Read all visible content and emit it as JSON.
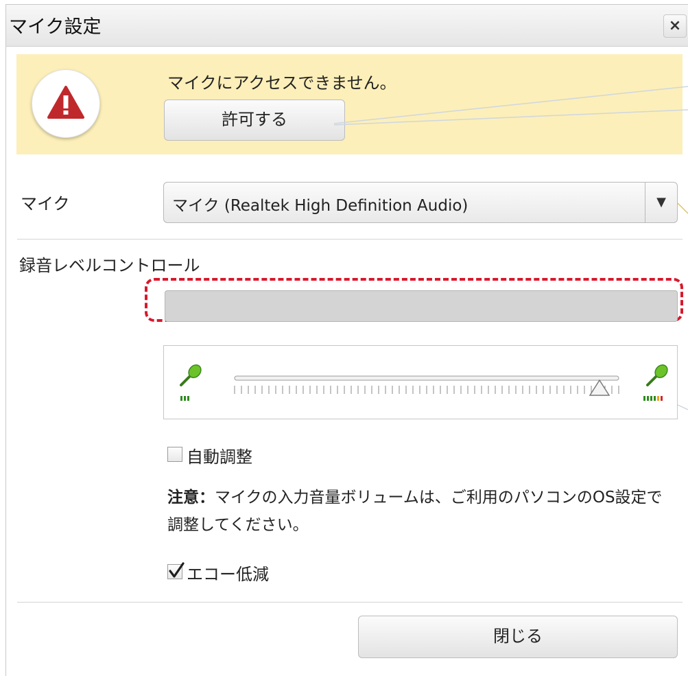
{
  "dialog": {
    "title": "マイク設定",
    "close_icon": "×"
  },
  "warning": {
    "icon": "warning-triangle-icon",
    "message": "マイクにアクセスできません。",
    "allow_button": "許可する",
    "background_color": "#fcefb9",
    "icon_color": "#c0292c"
  },
  "mic": {
    "label": "マイク",
    "selected_device": "マイク (Realtek High Definition Audio)",
    "dropdown_icon": "▼"
  },
  "recording": {
    "label": "録音レベルコントロール",
    "highlight_color": "#d8182d",
    "slider_level": 0.95
  },
  "auto_adjust": {
    "label": "自動調整",
    "checked": false
  },
  "note": {
    "prefix": "注意：",
    "text": "マイクの入力音量ボリュームは、ご利用のパソコンのOS設定で調整してください。"
  },
  "echo_reduction": {
    "label": "エコー低減",
    "checked": true,
    "check_mark": "✓"
  },
  "footer": {
    "close_button": "閉じる"
  }
}
